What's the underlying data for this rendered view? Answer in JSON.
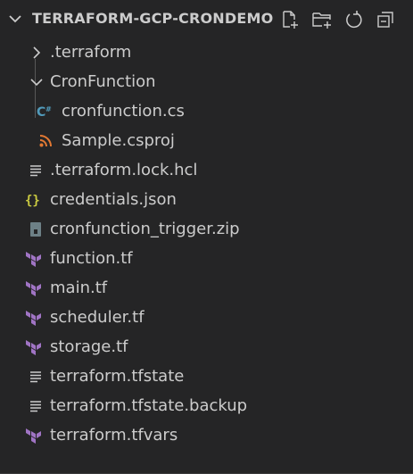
{
  "explorer": {
    "title": "TERRAFORM-GCP-CRONDEMO",
    "actions": [
      {
        "name": "new-file-icon"
      },
      {
        "name": "new-folder-icon"
      },
      {
        "name": "refresh-icon"
      },
      {
        "name": "collapse-all-icon"
      }
    ],
    "items": [
      {
        "label": ".terraform",
        "icon": "chevron-right-icon",
        "type": "folder"
      },
      {
        "label": "CronFunction",
        "icon": "chevron-down-icon",
        "type": "folder-open"
      },
      {
        "label": "cronfunction.cs",
        "icon": "csharp-icon",
        "type": "file"
      },
      {
        "label": "Sample.csproj",
        "icon": "rss-icon",
        "type": "file"
      },
      {
        "label": ".terraform.lock.hcl",
        "icon": "lines-icon",
        "type": "file"
      },
      {
        "label": "credentials.json",
        "icon": "json-icon",
        "type": "file"
      },
      {
        "label": "cronfunction_trigger.zip",
        "icon": "zip-icon",
        "type": "file"
      },
      {
        "label": "function.tf",
        "icon": "terraform-icon",
        "type": "file"
      },
      {
        "label": "main.tf",
        "icon": "terraform-icon",
        "type": "file"
      },
      {
        "label": "scheduler.tf",
        "icon": "terraform-icon",
        "type": "file"
      },
      {
        "label": "storage.tf",
        "icon": "terraform-icon",
        "type": "file"
      },
      {
        "label": "terraform.tfstate",
        "icon": "lines-icon",
        "type": "file"
      },
      {
        "label": "terraform.tfstate.backup",
        "icon": "lines-icon",
        "type": "file"
      },
      {
        "label": "terraform.tfvars",
        "icon": "terraform-icon",
        "type": "file"
      }
    ]
  },
  "colors": {
    "background": "#252526",
    "text": "#cccccc",
    "csharp": "#519aba",
    "rss": "#e37933",
    "json": "#cbcb41",
    "terraform": "#a074c4",
    "lines": "#cccccc",
    "zip": "#6d8086"
  }
}
